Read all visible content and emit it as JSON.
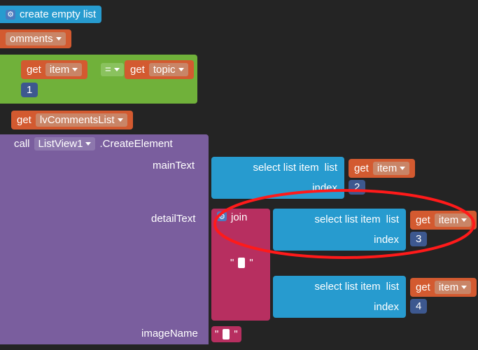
{
  "blocks": {
    "create_empty": "create empty list",
    "comments_var": "omments",
    "get1": "get",
    "item1": "item",
    "eq": "=",
    "get2": "get",
    "topic": "topic",
    "num1": "1",
    "get_lvlist": "get",
    "lvCommentsList": "lvCommentsList",
    "call": "call",
    "ListView1": "ListView1",
    "createElement": ".CreateElement",
    "mainText": "mainText",
    "detailText": "detailText",
    "imageName": "imageName",
    "select_list_item": "select list item",
    "list_lbl": "list",
    "index_lbl": "index",
    "get": "get",
    "item": "item",
    "idx2": "2",
    "idx3": "3",
    "idx4": "4",
    "join": "join",
    "quote": "\"",
    "quote2": "\""
  }
}
